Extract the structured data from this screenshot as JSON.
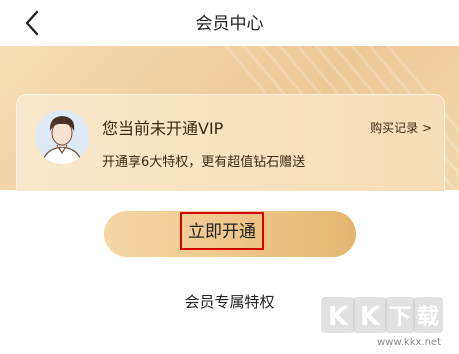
{
  "header": {
    "title": "会员中心",
    "back_icon": "chevron-left-icon"
  },
  "member_card": {
    "status_text": "您当前未开通VIP",
    "purchase_link": "购买记录 >",
    "benefit_text": "开通享6大特权，更有超值钻石赠送",
    "avatar_icon": "user-avatar-icon"
  },
  "open_button": {
    "label": "立即开通",
    "highlight_color": "#d40000"
  },
  "section": {
    "title": "会员专属特权"
  },
  "watermark": {
    "logo_text": "KK下载",
    "url": "www.kkx.net"
  },
  "colors": {
    "gold_light": "#f6dfb8",
    "gold_dark": "#e5b671",
    "text_dark": "#3a2a14"
  }
}
